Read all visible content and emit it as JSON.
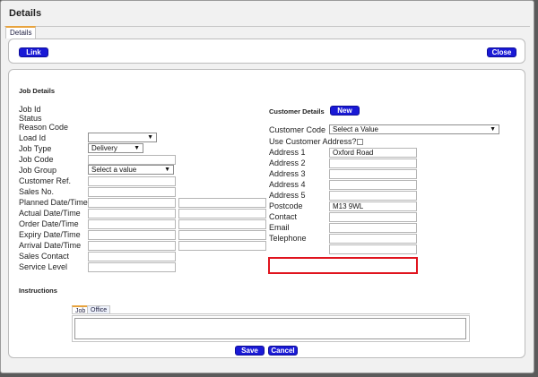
{
  "title": "Details",
  "tab": "Details",
  "toolbar": {
    "link": "Link",
    "close": "Close"
  },
  "section": "Job Details",
  "left_labels": [
    "Job Id",
    "Status",
    "Reason Code",
    "Load Id",
    "Job Type",
    "Job Code",
    "Job Group",
    "Customer Ref.",
    "Sales No.",
    "Planned Date/Time",
    "Actual Date/Time",
    "Order Date/Time",
    "Expiry Date/Time",
    "Arrival Date/Time",
    "Sales Contact",
    "Service Level"
  ],
  "job_type_value": "Delivery",
  "job_group_value": "Select a value",
  "customer_details": "Customer Details",
  "new_button": "New",
  "customer_code_label": "Customer Code",
  "customer_code_value": "Select a Value",
  "use_address_label": "Use Customer Address?",
  "address_labels": [
    "Address 1",
    "Address 2",
    "Address 3",
    "Address 4",
    "Address 5",
    "Postcode",
    "Contact",
    "Email",
    "Telephone"
  ],
  "address1_value": "Oxford Road",
  "postcode_value": "M13 9WL",
  "instructions": "Instructions",
  "inner_tabs": [
    "Job",
    "Office"
  ],
  "save": "Save",
  "cancel": "Cancel",
  "highlight_color": "#e0141e"
}
